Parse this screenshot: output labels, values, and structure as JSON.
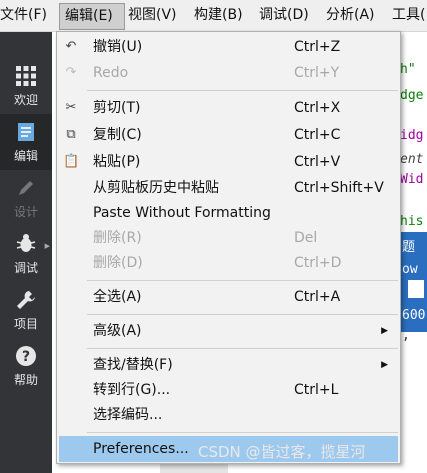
{
  "menubar": {
    "items": [
      "文件(F)",
      "编辑(E)",
      "视图(V)",
      "构建(B)",
      "调试(D)",
      "分析(A)",
      "工具("
    ]
  },
  "sidebar": {
    "items": [
      {
        "label": "欢迎",
        "icon": "grid-icon"
      },
      {
        "label": "编辑",
        "icon": "document-icon"
      },
      {
        "label": "设计",
        "icon": "pencil-icon"
      },
      {
        "label": "调试",
        "icon": "bug-icon"
      },
      {
        "label": "项目",
        "icon": "wrench-icon"
      },
      {
        "label": "帮助",
        "icon": "question-icon"
      }
    ]
  },
  "editor_fragments": [
    "h\"",
    "dge",
    "idg",
    "ent",
    "Wid",
    "his",
    "题",
    "ow",
    "600",
    ", "
  ],
  "edit_menu": {
    "items": [
      {
        "label": "撤销(U)",
        "shortcut": "Ctrl+Z",
        "icon": "undo-icon",
        "enabled": true
      },
      {
        "label": "Redo",
        "shortcut": "Ctrl+Y",
        "icon": "redo-icon",
        "enabled": false
      },
      {
        "label": "剪切(T)",
        "shortcut": "Ctrl+X",
        "icon": "scissors-icon",
        "enabled": true
      },
      {
        "label": "复制(C)",
        "shortcut": "Ctrl+C",
        "icon": "copy-icon",
        "enabled": true
      },
      {
        "label": "粘贴(P)",
        "shortcut": "Ctrl+V",
        "icon": "paste-icon",
        "enabled": true
      },
      {
        "label": "从剪贴板历史中粘贴",
        "shortcut": "Ctrl+Shift+V",
        "enabled": true
      },
      {
        "label": "Paste Without Formatting",
        "shortcut": "",
        "enabled": true
      },
      {
        "label": "删除(R)",
        "shortcut": "Del",
        "enabled": false
      },
      {
        "label": "删除(D)",
        "shortcut": "Ctrl+D",
        "enabled": false
      },
      {
        "label": "全选(A)",
        "shortcut": "Ctrl+A",
        "enabled": true
      },
      {
        "label": "高级(A)",
        "shortcut": "",
        "submenu": true,
        "enabled": true
      },
      {
        "label": "查找/替换(F)",
        "shortcut": "",
        "submenu": true,
        "enabled": true
      },
      {
        "label": "转到行(G)...",
        "shortcut": "Ctrl+L",
        "enabled": true
      },
      {
        "label": "选择编码...",
        "shortcut": "",
        "enabled": true
      },
      {
        "label": "Preferences...",
        "shortcut": "",
        "enabled": true,
        "highlighted": true
      }
    ]
  },
  "watermark": "CSDN @皆过客，揽星河",
  "colors": {
    "highlight": "#9ec9ef",
    "sidebar": "#333437",
    "menu_bg": "#f2f2f2"
  }
}
